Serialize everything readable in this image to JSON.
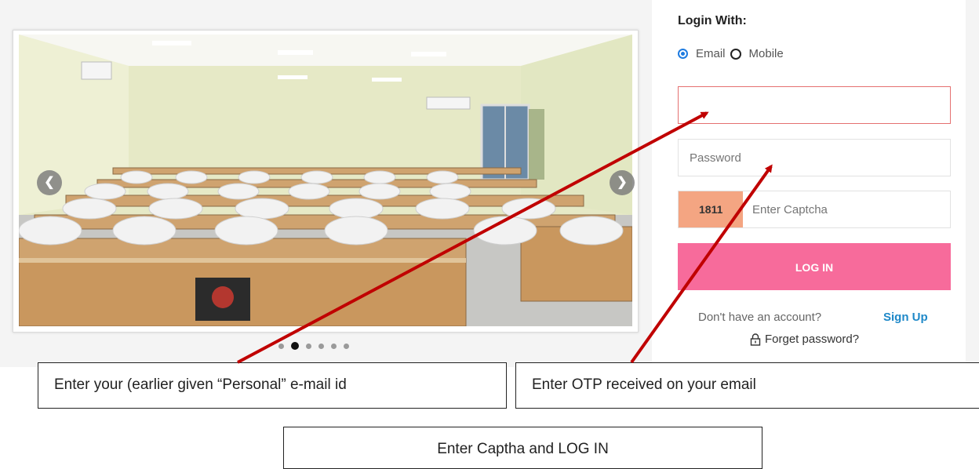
{
  "login": {
    "heading": "Login With:",
    "option_email": "Email",
    "option_mobile": "Mobile",
    "email_value": "",
    "password_placeholder": "Password",
    "captcha_code": "1811",
    "captcha_placeholder": "Enter Captcha",
    "login_button": "LOG IN",
    "no_account_text": "Don't have an account?",
    "signup_link": "Sign Up",
    "forget_password": "Forget password?"
  },
  "slider": {
    "slide_count": 6,
    "active_index": 1
  },
  "callouts": {
    "email": "Enter your (earlier given “Personal” e-mail id",
    "otp": "Enter OTP received on your email",
    "captcha": "Enter Captha and LOG IN"
  },
  "colors": {
    "login_button": "#f76b9b",
    "captcha_bg": "#f4a582",
    "signup_link": "#1e88c8",
    "arrow": "#c00000",
    "email_border": "#e57070"
  }
}
